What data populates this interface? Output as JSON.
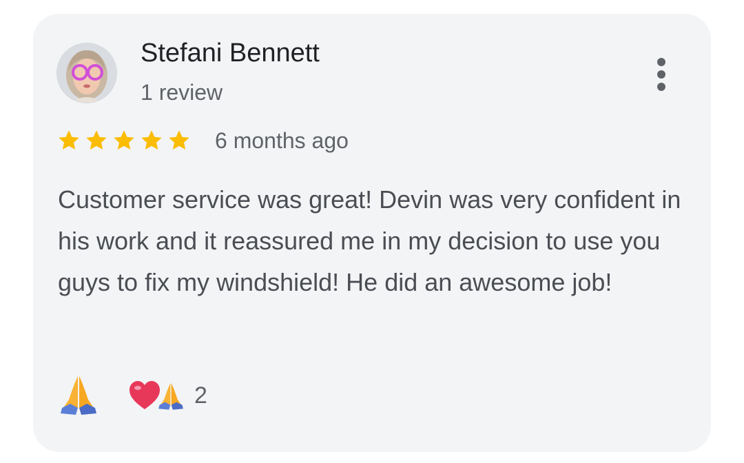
{
  "review": {
    "reviewer_name": "Stefani Bennett",
    "review_count": "1 review",
    "rating": 5,
    "rating_max": 5,
    "time_ago": "6 months ago",
    "text": "Customer service was great! Devin was very confident in his work and it reassured me in my decision to use you guys to fix my windshield! He did an awesome job!",
    "reaction_count": "2"
  },
  "icons": {
    "avatar": "profile-photo",
    "menu": "more-vert-icon",
    "star": "star-icon",
    "react": "folded-hands-icon",
    "reactions": [
      "heart-icon",
      "folded-hands-icon"
    ]
  },
  "colors": {
    "card_background": "#f3f4f6",
    "star": "#fbbc04",
    "name": "#202124",
    "secondary_text": "#5f6368",
    "body_text": "#4a4d52",
    "heart": "#e8385a",
    "hands": "#f9b233"
  }
}
